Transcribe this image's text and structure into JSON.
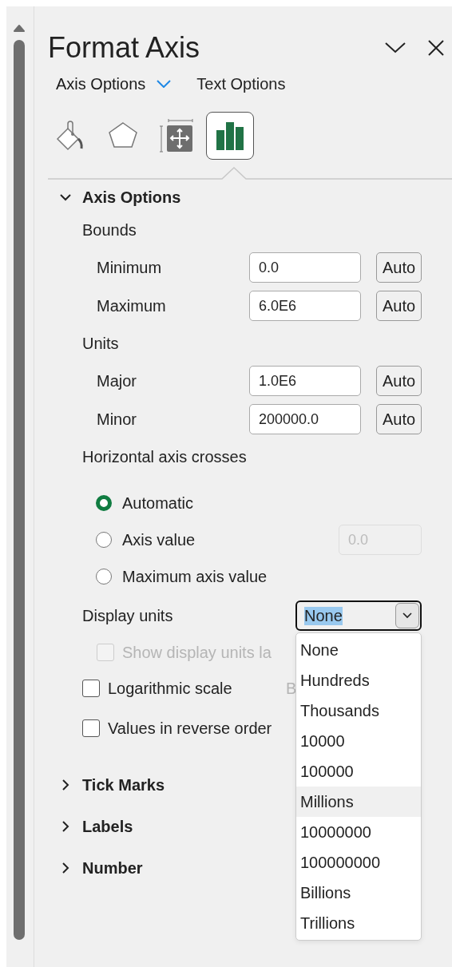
{
  "pane": {
    "title": "Format Axis"
  },
  "option_tabs": [
    {
      "label": "Axis Options",
      "selected": true
    },
    {
      "label": "Text Options",
      "selected": false
    }
  ],
  "icon_tabs": [
    {
      "kind": "fill",
      "selected": false
    },
    {
      "kind": "effects",
      "selected": false
    },
    {
      "kind": "size",
      "selected": false
    },
    {
      "kind": "axis",
      "selected": true
    }
  ],
  "axis_options": {
    "title": "Axis Options",
    "expanded": true,
    "groups": [
      {
        "heading": "Bounds",
        "fields": [
          {
            "label": "Minimum",
            "value": "0.0",
            "button": "Auto"
          },
          {
            "label": "Maximum",
            "value": "6.0E6",
            "button": "Auto"
          }
        ]
      },
      {
        "heading": "Units",
        "fields": [
          {
            "label": "Major",
            "value": "1.0E6",
            "button": "Auto"
          },
          {
            "label": "Minor",
            "value": "200000.0",
            "button": "Auto"
          }
        ]
      }
    ],
    "crosses": {
      "heading": "Horizontal axis crosses",
      "options": [
        {
          "label": "Automatic",
          "selected": true
        },
        {
          "label": "Axis value",
          "selected": false,
          "value": "0.0",
          "disabled": true
        },
        {
          "label": "Maximum axis value",
          "selected": false
        }
      ]
    },
    "display_units": {
      "label": "Display units",
      "value": "None",
      "open": true,
      "options": [
        {
          "label": "None",
          "hovered": false
        },
        {
          "label": "Hundreds",
          "hovered": false
        },
        {
          "label": "Thousands",
          "hovered": false
        },
        {
          "label": "10000",
          "hovered": false
        },
        {
          "label": "100000",
          "hovered": false
        },
        {
          "label": "Millions",
          "hovered": true
        },
        {
          "label": "10000000",
          "hovered": false
        },
        {
          "label": "100000000",
          "hovered": false
        },
        {
          "label": "Billions",
          "hovered": false
        },
        {
          "label": "Trillions",
          "hovered": false
        }
      ],
      "sub_checkbox": {
        "label": "Show display units la",
        "checked": false,
        "disabled": true
      }
    },
    "checkboxes": [
      {
        "label": "Logarithmic scale",
        "checked": false,
        "disabled": false,
        "note": "B"
      },
      {
        "label": "Values in reverse order",
        "checked": false,
        "disabled": false
      }
    ]
  },
  "collapsed_sections": [
    {
      "title": "Tick Marks",
      "expanded": false
    },
    {
      "title": "Labels",
      "expanded": false
    },
    {
      "title": "Number",
      "expanded": false
    }
  ]
}
